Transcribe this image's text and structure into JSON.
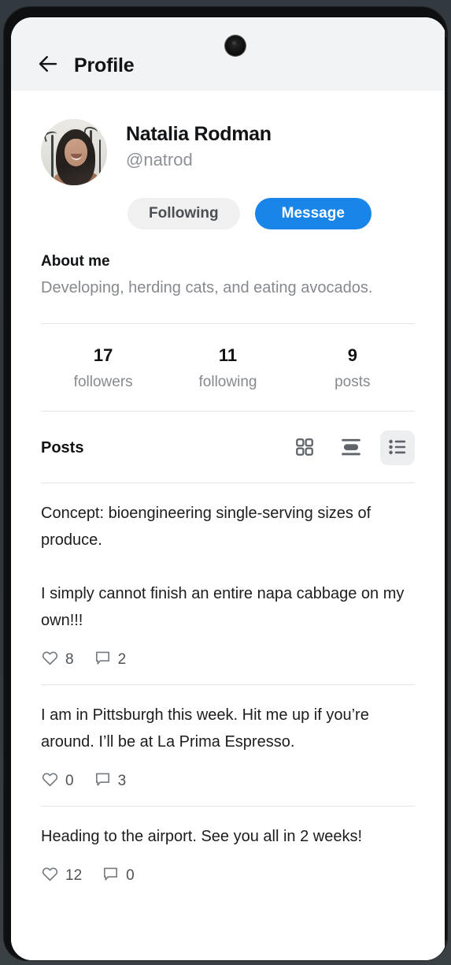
{
  "app_bar": {
    "title": "Profile",
    "back_icon": "arrow-left-icon"
  },
  "device": {
    "camera_icon": "front-camera-punch-hole"
  },
  "profile": {
    "avatar_alt": "profile-photo",
    "display_name": "Natalia Rodman",
    "handle": "@natrod",
    "actions": {
      "following_label": "Following",
      "message_label": "Message"
    },
    "about": {
      "title": "About me",
      "text": "Developing, herding cats, and eating avocados."
    },
    "stats": [
      {
        "value": "17",
        "label": "followers"
      },
      {
        "value": "11",
        "label": "following"
      },
      {
        "value": "9",
        "label": "posts"
      }
    ]
  },
  "posts_section": {
    "title": "Posts",
    "view_toggle": [
      {
        "icon": "grid-view-icon",
        "selected": false
      },
      {
        "icon": "card-view-icon",
        "selected": false
      },
      {
        "icon": "list-view-icon",
        "selected": true
      }
    ],
    "posts": [
      {
        "text": "Concept: bioengineering single-serving sizes of produce.\n\nI simply cannot finish an entire napa cabbage on my own!!!",
        "likes": "8",
        "comments": "2"
      },
      {
        "text": "I am in Pittsburgh this week. Hit me up if you’re around. I’ll be at La Prima Espresso.",
        "likes": "0",
        "comments": "3"
      },
      {
        "text": "Heading to the airport. See you all in 2 weeks!",
        "likes": "12",
        "comments": "0"
      }
    ]
  },
  "colors": {
    "accent_blue": "#1a85e8",
    "app_bar_bg": "#f2f3f4",
    "muted_text": "#86898e",
    "selected_toggle_bg": "#eceef0",
    "divider": "#e4e5e6"
  }
}
